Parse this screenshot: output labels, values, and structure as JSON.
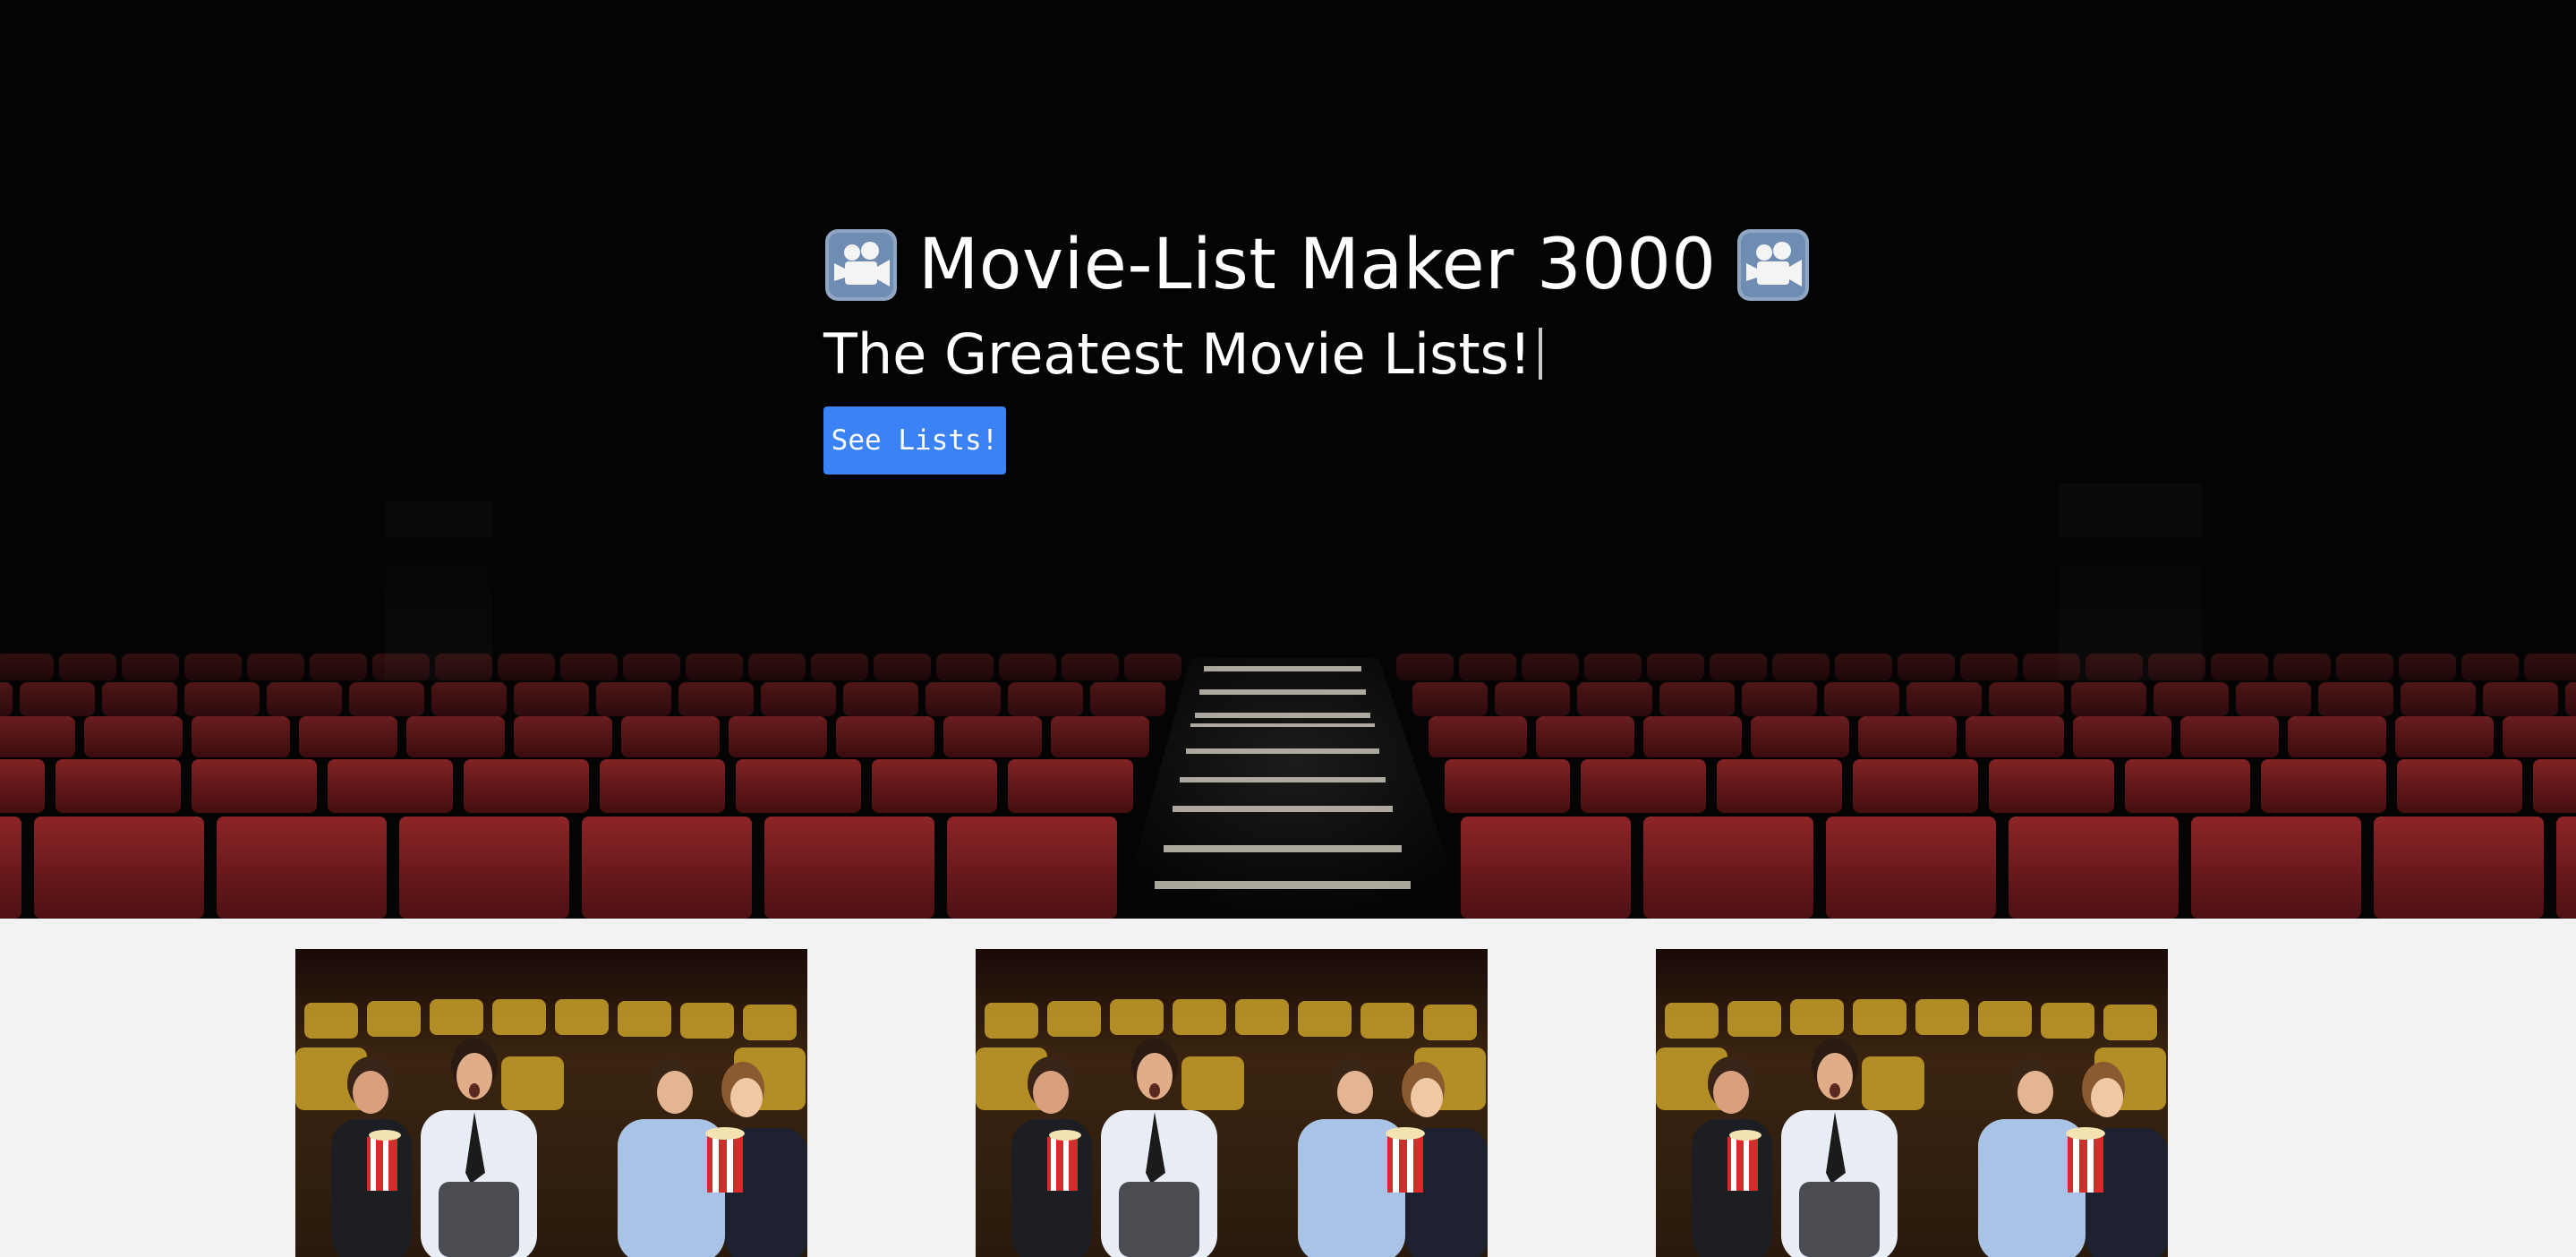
{
  "hero": {
    "title": "Movie-List Maker 3000",
    "subtitle": "The Greatest Movie Lists!",
    "button_label": "See Lists!",
    "title_icons": [
      "movie-camera-icon",
      "movie-camera-icon"
    ]
  },
  "cards": [
    {
      "image": "audience-watching-movie-photo"
    },
    {
      "image": "audience-watching-movie-photo"
    },
    {
      "image": "audience-watching-movie-photo"
    }
  ],
  "colors": {
    "button": "#3b82f6",
    "hero_background": "#050505",
    "seats": "#7a1c1e",
    "page_background": "#f2f2f2"
  }
}
